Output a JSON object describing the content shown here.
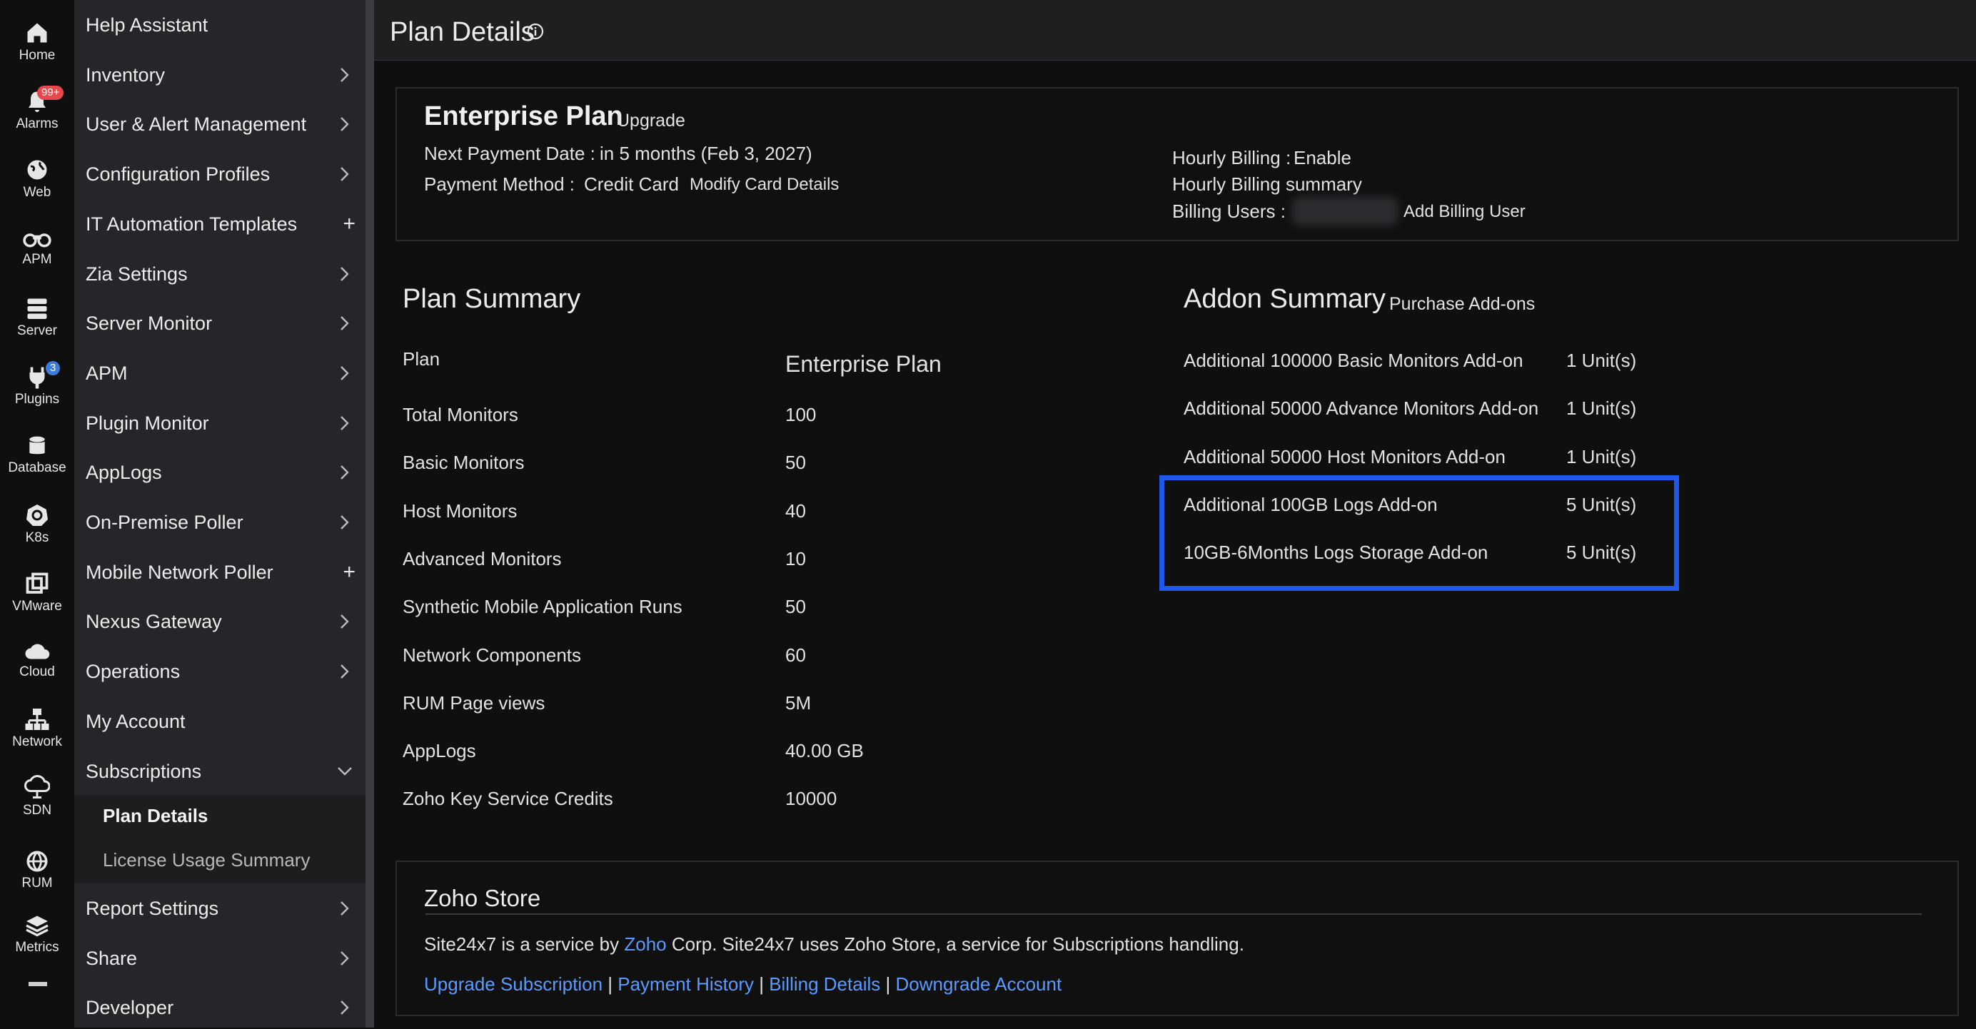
{
  "rail": [
    {
      "label": "Home",
      "icon": "home-icon"
    },
    {
      "label": "Alarms",
      "icon": "bell-icon",
      "badge": "99+"
    },
    {
      "label": "Web",
      "icon": "globe-icon"
    },
    {
      "label": "APM",
      "icon": "binoculars-icon"
    },
    {
      "label": "Server",
      "icon": "server-icon"
    },
    {
      "label": "Plugins",
      "icon": "plug-icon",
      "badge": "3"
    },
    {
      "label": "Database",
      "icon": "database-icon"
    },
    {
      "label": "K8s",
      "icon": "kubernetes-icon"
    },
    {
      "label": "VMware",
      "icon": "vmware-icon"
    },
    {
      "label": "Cloud",
      "icon": "cloud-icon"
    },
    {
      "label": "Network",
      "icon": "network-icon"
    },
    {
      "label": "SDN",
      "icon": "sdn-cloud-icon"
    },
    {
      "label": "RUM",
      "icon": "rum-globe-icon"
    },
    {
      "label": "Metrics",
      "icon": "layers-icon"
    }
  ],
  "menu": {
    "items": [
      {
        "label": "Help Assistant",
        "indicator": "none"
      },
      {
        "label": "Inventory",
        "indicator": "chevron"
      },
      {
        "label": "User & Alert Management",
        "indicator": "chevron"
      },
      {
        "label": "Configuration Profiles",
        "indicator": "chevron"
      },
      {
        "label": "IT Automation Templates",
        "indicator": "plus"
      },
      {
        "label": "Zia Settings",
        "indicator": "chevron"
      },
      {
        "label": "Server Monitor",
        "indicator": "chevron"
      },
      {
        "label": "APM",
        "indicator": "chevron"
      },
      {
        "label": "Plugin Monitor",
        "indicator": "chevron"
      },
      {
        "label": "AppLogs",
        "indicator": "chevron"
      },
      {
        "label": "On-Premise Poller",
        "indicator": "chevron"
      },
      {
        "label": "Mobile Network Poller",
        "indicator": "plus"
      },
      {
        "label": "Nexus Gateway",
        "indicator": "chevron"
      },
      {
        "label": "Operations",
        "indicator": "chevron"
      },
      {
        "label": "My Account",
        "indicator": "none"
      },
      {
        "label": "Subscriptions",
        "indicator": "chevron-down"
      }
    ],
    "sub_items": [
      {
        "label": "Plan Details",
        "active": true
      },
      {
        "label": "License Usage Summary",
        "active": false
      }
    ],
    "items_after": [
      {
        "label": "Report Settings",
        "indicator": "chevron"
      },
      {
        "label": "Share",
        "indicator": "chevron"
      },
      {
        "label": "Developer",
        "indicator": "chevron"
      }
    ]
  },
  "header": {
    "title": "Plan Details"
  },
  "plan": {
    "name": "Enterprise Plan",
    "upgrade_link": "Upgrade",
    "next_payment_label": "Next Payment Date :",
    "next_payment_value": "in 5 months (Feb 3, 2027)",
    "payment_method_label": "Payment Method :",
    "payment_method_value": "Credit Card",
    "modify_card_link": "Modify Card Details",
    "hourly_billing_label": "Hourly Billing :",
    "hourly_billing_link": "Enable",
    "hourly_summary_link": "Hourly Billing summary",
    "billing_users_label": "Billing Users :",
    "add_billing_user_link": "Add Billing User"
  },
  "plan_summary": {
    "title": "Plan Summary",
    "rows": [
      {
        "label": "Plan",
        "value": "Enterprise Plan"
      },
      {
        "label": "Total Monitors",
        "value": "100"
      },
      {
        "label": "Basic Monitors",
        "value": "50"
      },
      {
        "label": "Host Monitors",
        "value": "40"
      },
      {
        "label": "Advanced Monitors",
        "value": "10"
      },
      {
        "label": "Synthetic Mobile Application Runs",
        "value": "50"
      },
      {
        "label": "Network Components",
        "value": "60"
      },
      {
        "label": "RUM Page views",
        "value": "5M"
      },
      {
        "label": "AppLogs",
        "value": "40.00 GB"
      },
      {
        "label": "Zoho Key Service Credits",
        "value": "10000"
      }
    ]
  },
  "addon_summary": {
    "title": "Addon Summary",
    "purchase_link": "Purchase Add-ons",
    "rows": [
      {
        "label": "Additional 100000 Basic Monitors Add-on",
        "value": "1 Unit(s)"
      },
      {
        "label": "Additional 50000 Advance Monitors Add-on",
        "value": "1 Unit(s)"
      },
      {
        "label": "Additional 50000 Host Monitors Add-on",
        "value": "1 Unit(s)"
      },
      {
        "label": "Additional 100GB Logs Add-on",
        "value": "5 Unit(s)"
      },
      {
        "label": "10GB-6Months Logs Storage Add-on",
        "value": "5 Unit(s)"
      }
    ]
  },
  "store": {
    "title": "Zoho Store",
    "desc_before": "Site24x7 is a service by ",
    "desc_link": "Zoho",
    "desc_after": " Corp. Site24x7 uses Zoho Store, a service for Subscriptions handling.",
    "links": [
      "Upgrade Subscription",
      "Payment History",
      "Billing Details",
      "Downgrade Account"
    ],
    "separator": " | "
  },
  "colors": {
    "accent": "#5b9bff",
    "highlight": "#1f57e8",
    "menu_bg": "#252629",
    "bg": "#0f0f10"
  }
}
